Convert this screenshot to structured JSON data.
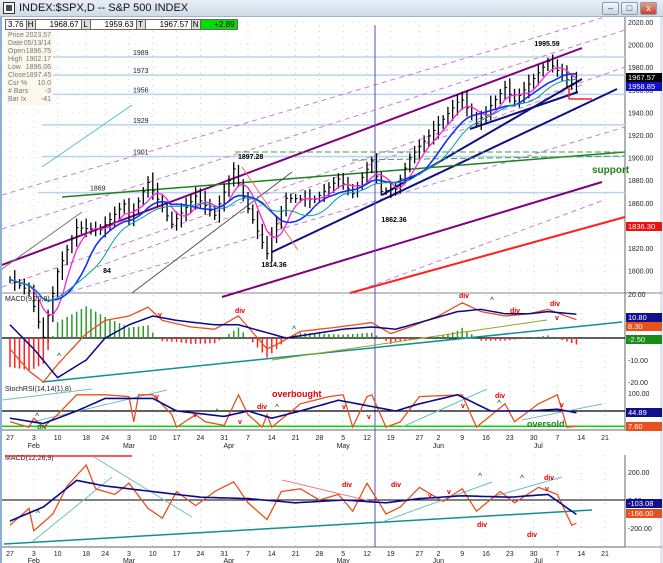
{
  "window": {
    "title": "INDEX:$SPX,D -- S&P 500 INDEX",
    "min": "–",
    "max": "□",
    "close": "x"
  },
  "header": {
    "o_partial": "3.76",
    "h_label": "H",
    "h": "1968.67",
    "l_label": "L",
    "l": "1959.63",
    "t_label": "T",
    "t": "1967.57",
    "n_label": "N",
    "n": "+2.89"
  },
  "info": [
    [
      "Price",
      "2023.57"
    ],
    [
      "Date",
      "05/13/14"
    ],
    [
      "Open",
      "1896.75"
    ],
    [
      "High",
      "1902.17"
    ],
    [
      "Low",
      "1896.06"
    ],
    [
      "Close",
      "1897.45"
    ],
    [
      "Csr %",
      "10.0"
    ],
    [
      "# Bars",
      "-3"
    ],
    [
      "Bar Ix",
      "-41"
    ]
  ],
  "colors": {
    "up": "#000000",
    "macd": "#e8501e",
    "signal": "#0a0a8c",
    "hist_pos": "#2a9a2a",
    "hist_neg": "#ff2020",
    "fib": "#b9d3f0",
    "channel": "#800080",
    "support": "#208020"
  },
  "chart_data": [
    {
      "type": "ohlc",
      "title": "S&P 500 INDEX daily",
      "ylim": [
        1780,
        2020
      ],
      "yticks": [
        "2020.00",
        "2000.00",
        "1980.00",
        "1960.00",
        "1940.00",
        "1920.00",
        "1900.00",
        "1880.00",
        "1860.00",
        "1840.00",
        "1820.00",
        "1800.00"
      ],
      "anchors": [
        [
          "01-27",
          1792
        ],
        [
          "01-31",
          1782
        ],
        [
          "02-05",
          1741
        ],
        [
          "02-10",
          1799
        ],
        [
          "02-14",
          1838
        ],
        [
          "02-21",
          1836
        ],
        [
          "02-28",
          1859
        ],
        [
          "03-03",
          1845
        ],
        [
          "03-07",
          1878
        ],
        [
          "03-14",
          1841
        ],
        [
          "03-21",
          1866
        ],
        [
          "03-27",
          1849
        ],
        [
          "04-02",
          1890
        ],
        [
          "04-04",
          1865
        ],
        [
          "04-11",
          1815
        ],
        [
          "04-14",
          1830
        ],
        [
          "04-17",
          1864
        ],
        [
          "04-25",
          1863
        ],
        [
          "05-02",
          1881
        ],
        [
          "05-07",
          1868
        ],
        [
          "05-13",
          1897
        ],
        [
          "05-15",
          1870
        ],
        [
          "05-20",
          1872
        ],
        [
          "05-23",
          1900
        ],
        [
          "05-30",
          1924
        ],
        [
          "06-06",
          1949
        ],
        [
          "06-09",
          1951
        ],
        [
          "06-12",
          1930
        ],
        [
          "06-20",
          1962
        ],
        [
          "06-24",
          1950
        ],
        [
          "07-03",
          1985
        ],
        [
          "07-07",
          1977
        ],
        [
          "07-10",
          1965
        ],
        [
          "07-11",
          1967
        ]
      ],
      "fib_levels": [
        {
          "label": "1989",
          "v": 1989
        },
        {
          "label": "1973",
          "v": 1973
        },
        {
          "label": "1956",
          "v": 1956
        },
        {
          "label": "1929",
          "v": 1929
        },
        {
          "label": "1901",
          "v": 1901
        },
        {
          "label": "1869",
          "v": 1869
        }
      ],
      "annotations": {
        "high1": "1897.28",
        "low1": "1814.36",
        "low2": "1862.36",
        "high2": "1995.59",
        "small": "84",
        "support": "support"
      },
      "last": {
        "price": "1967.57",
        "ma": "1958.85",
        "ma200": "1836.30"
      }
    },
    {
      "type": "line",
      "title": "MACD(9,20,9)",
      "ylim": [
        -25,
        22
      ],
      "yticks": [
        "20.00",
        "10.00",
        "0.00",
        "-10.00",
        "-20.00"
      ],
      "macd": [
        [
          "01-27",
          -5
        ],
        [
          "01-31",
          -15
        ],
        [
          "02-05",
          -20
        ],
        [
          "02-10",
          -12
        ],
        [
          "02-18",
          2
        ],
        [
          "02-24",
          8
        ],
        [
          "03-03",
          10
        ],
        [
          "03-07",
          14
        ],
        [
          "03-12",
          8
        ],
        [
          "03-20",
          5
        ],
        [
          "03-27",
          4
        ],
        [
          "04-03",
          10
        ],
        [
          "04-07",
          5
        ],
        [
          "04-11",
          -5
        ],
        [
          "04-15",
          -3
        ],
        [
          "04-22",
          3
        ],
        [
          "05-02",
          5
        ],
        [
          "05-13",
          7
        ],
        [
          "05-19",
          2
        ],
        [
          "05-23",
          5
        ],
        [
          "06-02",
          10
        ],
        [
          "06-09",
          16
        ],
        [
          "06-13",
          12
        ],
        [
          "06-20",
          10
        ],
        [
          "06-27",
          11
        ],
        [
          "07-03",
          13
        ],
        [
          "07-11",
          8.3
        ]
      ],
      "signal": [
        [
          "01-27",
          6
        ],
        [
          "02-03",
          -5
        ],
        [
          "02-10",
          -18
        ],
        [
          "02-18",
          -10
        ],
        [
          "02-24",
          0
        ],
        [
          "03-03",
          6
        ],
        [
          "03-10",
          10
        ],
        [
          "03-17",
          8
        ],
        [
          "03-27",
          6
        ],
        [
          "04-03",
          6
        ],
        [
          "04-10",
          3
        ],
        [
          "04-17",
          0
        ],
        [
          "04-25",
          2
        ],
        [
          "05-05",
          4
        ],
        [
          "05-13",
          5
        ],
        [
          "05-20",
          4
        ],
        [
          "05-27",
          7
        ],
        [
          "06-06",
          12
        ],
        [
          "06-13",
          13
        ],
        [
          "06-20",
          11
        ],
        [
          "06-27",
          11
        ],
        [
          "07-03",
          12
        ],
        [
          "07-11",
          10.8
        ]
      ],
      "last": {
        "signal": "10.80",
        "macd": "8.30",
        "hist": "-2.50"
      },
      "labels": {
        "div": "div",
        "up": "^",
        "down": "v"
      }
    },
    {
      "type": "line",
      "title": "StochRSI(14,14(1),8)",
      "ylim": [
        0,
        100
      ],
      "yticks": [
        "100.00",
        "0.00"
      ],
      "k": [
        [
          "01-27",
          20
        ],
        [
          "01-31",
          5
        ],
        [
          "02-03",
          30
        ],
        [
          "02-05",
          5
        ],
        [
          "02-10",
          40
        ],
        [
          "02-14",
          95
        ],
        [
          "02-24",
          95
        ],
        [
          "03-03",
          90
        ],
        [
          "03-04",
          20
        ],
        [
          "03-05",
          95
        ],
        [
          "03-10",
          95
        ],
        [
          "03-14",
          40
        ],
        [
          "03-17",
          5
        ],
        [
          "03-21",
          40
        ],
        [
          "03-25",
          20
        ],
        [
          "03-31",
          10
        ],
        [
          "04-03",
          95
        ],
        [
          "04-07",
          40
        ],
        [
          "04-10",
          5
        ],
        [
          "04-11",
          40
        ],
        [
          "04-14",
          5
        ],
        [
          "04-22",
          70
        ],
        [
          "04-30",
          90
        ],
        [
          "05-05",
          95
        ],
        [
          "05-07",
          5
        ],
        [
          "05-12",
          90
        ],
        [
          "05-13",
          95
        ],
        [
          "05-16",
          5
        ],
        [
          "05-21",
          20
        ],
        [
          "05-27",
          90
        ],
        [
          "06-09",
          95
        ],
        [
          "06-12",
          5
        ],
        [
          "06-20",
          70
        ],
        [
          "06-24",
          20
        ],
        [
          "07-01",
          70
        ],
        [
          "07-07",
          95
        ],
        [
          "07-09",
          5
        ],
        [
          "07-11",
          7.6
        ]
      ],
      "d": [
        [
          "01-27",
          30
        ],
        [
          "02-05",
          15
        ],
        [
          "02-14",
          50
        ],
        [
          "02-24",
          85
        ],
        [
          "03-10",
          85
        ],
        [
          "03-17",
          50
        ],
        [
          "03-31",
          35
        ],
        [
          "04-07",
          50
        ],
        [
          "04-14",
          30
        ],
        [
          "04-22",
          50
        ],
        [
          "05-02",
          80
        ],
        [
          "05-12",
          65
        ],
        [
          "05-20",
          50
        ],
        [
          "05-27",
          70
        ],
        [
          "06-06",
          95
        ],
        [
          "06-17",
          50
        ],
        [
          "06-27",
          50
        ],
        [
          "07-07",
          55
        ],
        [
          "07-11",
          44.89
        ]
      ],
      "last": {
        "d": "44.89",
        "k": "7.60"
      },
      "labels": {
        "overbought": "overbought",
        "oversold": "oversold",
        "div": "div",
        "up": "^",
        "down": "v"
      }
    },
    {
      "type": "line",
      "title": "MACD(12,26,9)",
      "ylim": [
        -260,
        260
      ],
      "yticks": [
        "200.00",
        "0.00",
        "-200.00"
      ],
      "macd": [
        [
          "01-27",
          -180
        ],
        [
          "01-31",
          -60
        ],
        [
          "02-03",
          -220
        ],
        [
          "02-07",
          -100
        ],
        [
          "02-12",
          100
        ],
        [
          "02-18",
          250
        ],
        [
          "02-20",
          80
        ],
        [
          "02-26",
          40
        ],
        [
          "03-03",
          120
        ],
        [
          "03-07",
          -60
        ],
        [
          "03-12",
          -130
        ],
        [
          "03-17",
          60
        ],
        [
          "03-21",
          -40
        ],
        [
          "03-27",
          60
        ],
        [
          "04-02",
          130
        ],
        [
          "04-07",
          -20
        ],
        [
          "04-11",
          -140
        ],
        [
          "04-16",
          60
        ],
        [
          "04-22",
          80
        ],
        [
          "04-28",
          0
        ],
        [
          "05-02",
          40
        ],
        [
          "05-07",
          -80
        ],
        [
          "05-12",
          120
        ],
        [
          "05-16",
          -100
        ],
        [
          "05-21",
          -50
        ],
        [
          "05-27",
          90
        ],
        [
          "06-03",
          -10
        ],
        [
          "06-09",
          80
        ],
        [
          "06-12",
          -80
        ],
        [
          "06-19",
          60
        ],
        [
          "06-24",
          -20
        ],
        [
          "07-01",
          90
        ],
        [
          "07-07",
          40
        ],
        [
          "07-10",
          -180
        ],
        [
          "07-11",
          -166
        ]
      ],
      "signal": [
        [
          "01-27",
          -150
        ],
        [
          "02-05",
          -50
        ],
        [
          "02-14",
          140
        ],
        [
          "02-24",
          100
        ],
        [
          "03-10",
          60
        ],
        [
          "03-24",
          20
        ],
        [
          "04-07",
          10
        ],
        [
          "04-21",
          -20
        ],
        [
          "05-05",
          0
        ],
        [
          "05-16",
          -20
        ],
        [
          "05-27",
          10
        ],
        [
          "06-09",
          30
        ],
        [
          "06-23",
          20
        ],
        [
          "07-03",
          40
        ],
        [
          "07-11",
          -103.08
        ]
      ],
      "last": {
        "signal": "-103.08",
        "macd": "-166.00"
      },
      "labels": {
        "div": "div",
        "up": "^",
        "down": "v"
      }
    }
  ],
  "xaxis": {
    "days": [
      [
        "01-27",
        "27"
      ],
      [
        "02-03",
        "3"
      ],
      [
        "02-10",
        "10"
      ],
      [
        "02-18",
        "18"
      ],
      [
        "02-24",
        "24"
      ],
      [
        "03-03",
        "3"
      ],
      [
        "03-10",
        "10"
      ],
      [
        "03-17",
        "17"
      ],
      [
        "03-24",
        "24"
      ],
      [
        "03-31",
        "31"
      ],
      [
        "04-07",
        "7"
      ],
      [
        "04-14",
        "14"
      ],
      [
        "04-21",
        "21"
      ],
      [
        "04-28",
        "28"
      ],
      [
        "05-05",
        "5"
      ],
      [
        "05-12",
        "12"
      ],
      [
        "05-19",
        "19"
      ],
      [
        "05-27",
        "27"
      ],
      [
        "06-02",
        "2"
      ],
      [
        "06-09",
        "9"
      ],
      [
        "06-16",
        "16"
      ],
      [
        "06-23",
        "23"
      ],
      [
        "06-30",
        "30"
      ],
      [
        "07-07",
        "7"
      ],
      [
        "07-14",
        "14"
      ],
      [
        "07-21",
        "21"
      ]
    ],
    "months": [
      [
        "02-03",
        "Feb"
      ],
      [
        "03-03",
        "Mar"
      ],
      [
        "04-01",
        "Apr"
      ],
      [
        "05-05",
        "May"
      ],
      [
        "06-02",
        "Jun"
      ],
      [
        "07-01",
        "Jul"
      ]
    ]
  }
}
